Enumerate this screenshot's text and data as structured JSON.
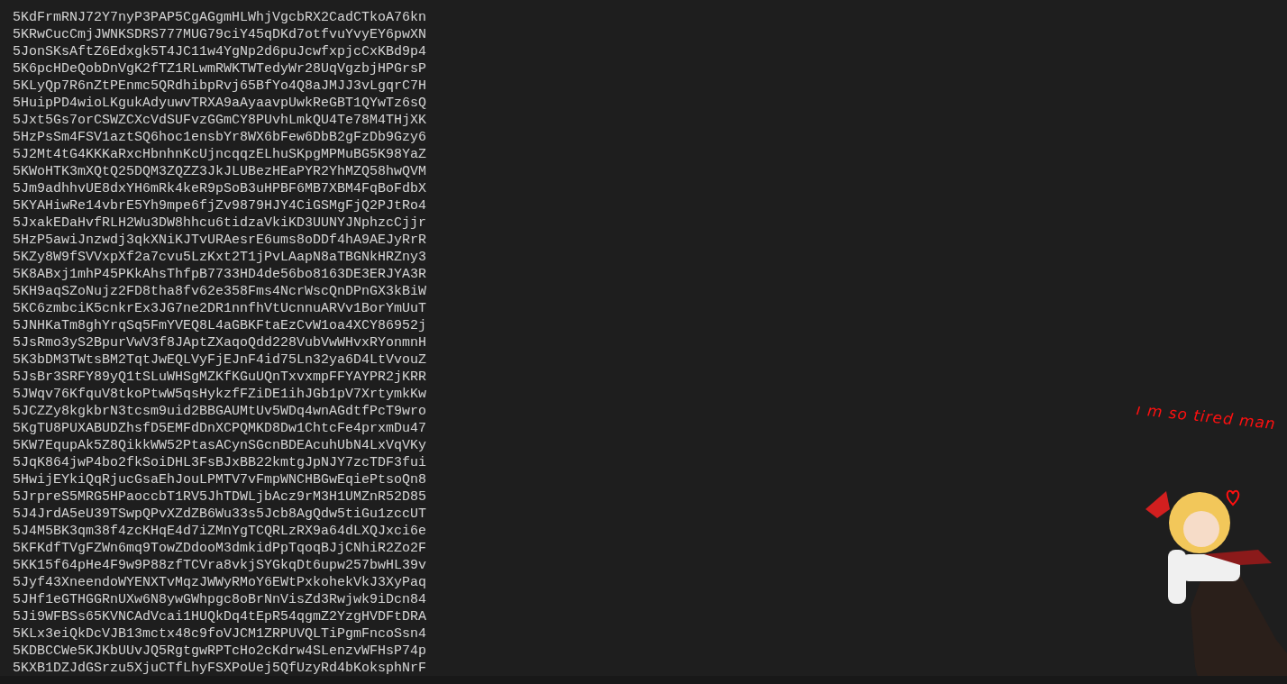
{
  "lines": [
    "5KdFrmRNJ72Y7nyP3PAP5CgAGgmHLWhjVgcbRX2CadCTkoA76kn",
    "5KRwCucCmjJWNKSDRS777MUG79ciY45qDKd7otfvuYvyEY6pwXN",
    "5JonSKsAftZ6Edxgk5T4JC11w4YgNp2d6puJcwfxpjcCxKBd9p4",
    "5K6pcHDeQobDnVgK2fTZ1RLwmRWKTWTedyWr28UqVgzbjHPGrsP",
    "5KLyQp7R6nZtPEnmc5QRdhibpRvj65BfYo4Q8aJMJJ3vLgqrC7H",
    "5HuipPD4wioLKgukAdyuwvTRXA9aAyaavpUwkReGBT1QYwTz6sQ",
    "5Jxt5Gs7orCSWZCXcVdSUFvzGGmCY8PUvhLmkQU4Te78M4THjXK",
    "5HzPsSm4FSV1aztSQ6hoc1ensbYr8WX6bFew6DbB2gFzDb9Gzy6",
    "5J2Mt4tG4KKKaRxcHbnhnKcUjncqqzELhuSKpgMPMuBG5K98YaZ",
    "5KWoHTK3mXQtQ25DQM3ZQZZ3JkJLUBezHEaPYR2YhMZQ58hwQVM",
    "5Jm9adhhvUE8dxYH6mRk4keR9pSoB3uHPBF6MB7XBM4FqBoFdbX",
    "5KYAHiwRe14vbrE5Yh9mpe6fjZv9879HJY4CiGSMgFjQ2PJtRo4",
    "5JxakEDaHvfRLH2Wu3DW8hhcu6tidzaVkiKD3UUNYJNphzcCjjr",
    "5HzP5awiJnzwdj3qkXNiKJTvURAesrE6ums8oDDf4hA9AEJyRrR",
    "5KZy8W9fSVVxpXf2a7cvu5LzKxt2T1jPvLAapN8aTBGNkHRZny3",
    "5K8ABxj1mhP45PKkAhsThfpB7733HD4de56bo8163DE3ERJYA3R",
    "5KH9aqSZoNujz2FD8tha8fv62e358Fms4NcrWscQnDPnGX3kBiW",
    "5KC6zmbciK5cnkrEx3JG7ne2DR1nnfhVtUcnnuARVv1BorYmUuT",
    "5JNHKaTm8ghYrqSq5FmYVEQ8L4aGBKFtaEzCvW1oa4XCY86952j",
    "5JsRmo3yS2BpurVwV3f8JAptZXaqoQdd228VubVwWHvxRYonmnH",
    "5K3bDM3TWtsBM2TqtJwEQLVyFjEJnF4id75Ln32ya6D4LtVvouZ",
    "5JsBr3SRFY89yQ1tSLuWHSgMZKfKGuUQnTxvxmpFFYAYPR2jKRR",
    "5JWqv76KfquV8tkoPtwW5qsHykzfFZiDE1ihJGb1pV7XrtymkKw",
    "5JCZZy8kgkbrN3tcsm9uid2BBGAUMtUv5WDq4wnAGdtfPcT9wro",
    "5KgTU8PUXABUDZhsfD5EMFdDnXCPQMKD8Dw1ChtcFe4prxmDu47",
    "5KW7EqupAk5Z8QikkWW52PtasACynSGcnBDEAcuhUbN4LxVqVKy",
    "5JqK864jwP4bo2fkSoiDHL3FsBJxBB22kmtgJpNJY7zcTDF3fui",
    "5HwijEYkiQqRjucGsaEhJouLPMTV7vFmpWNCHBGwEqiePtsoQn8",
    "5JrpreS5MRG5HPaoccbT1RV5JhTDWLjbAcz9rM3H1UMZnR52D85",
    "5J4JrdA5eU39TSwpQPvXZdZB6Wu33s5Jcb8AgQdw5tiGu1zccUT",
    "5J4M5BK3qm38f4zcKHqE4d7iZMnYgTCQRLzRX9a64dLXQJxci6e",
    "5KFKdfTVgFZWn6mq9TowZDdooM3dmkidPpTqoqBJjCNhiR2Zo2F",
    "5KK15f64pHe4F9w9P88zfTCVra8vkjSYGkqDt6upw257bwHL39v",
    "5Jyf43XneendoWYENXTvMqzJWWyRMoY6EWtPxkohekVkJ3XyPaq",
    "5JHf1eGTHGGRnUXw6N8ywGWhpgc8oBrNnVisZd3Rwjwk9iDcn84",
    "5Ji9WFBSs65KVNCAdVcai1HUQkDq4tEpR54qgmZ2YzgHVDFtDRA",
    "5KLx3eiQkDcVJB13mctx48c9foVJCM1ZRPUVQLTiPgmFncoSsn4",
    "5KDBCCWe5KJKbUUvJQ5RgtgwRPTcHo2cKdrw4SLenzvWFHsP74p",
    "5KXB1DZJdGSrzu5XjuCTfLhyFSXPoUej5QfUzyRd4bKoksphNrF"
  ],
  "handwritten_note": "ı m so tired man"
}
